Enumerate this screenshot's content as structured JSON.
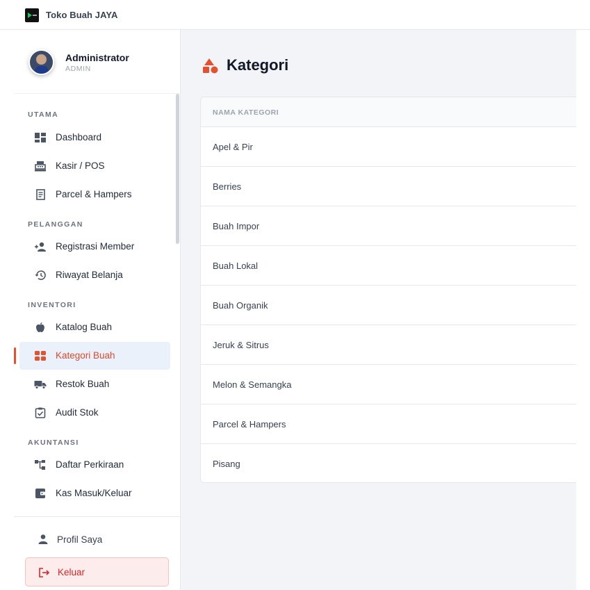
{
  "app": {
    "title": "Toko Buah JAYA"
  },
  "user": {
    "name": "Administrator",
    "role": "ADMIN"
  },
  "menu": {
    "sections": [
      {
        "title": "UTAMA",
        "items": [
          {
            "label": "Dashboard",
            "icon": "dashboard-icon"
          },
          {
            "label": "Kasir / POS",
            "icon": "cash-register-icon"
          },
          {
            "label": "Parcel & Hampers",
            "icon": "receipt-icon"
          }
        ]
      },
      {
        "title": "PELANGGAN",
        "items": [
          {
            "label": "Registrasi Member",
            "icon": "user-plus-icon"
          },
          {
            "label": "Riwayat Belanja",
            "icon": "history-icon"
          }
        ]
      },
      {
        "title": "INVENTORI",
        "items": [
          {
            "label": "Katalog Buah",
            "icon": "apple-icon"
          },
          {
            "label": "Kategori Buah",
            "icon": "grid-icon",
            "active": true
          },
          {
            "label": "Restok Buah",
            "icon": "truck-icon"
          },
          {
            "label": "Audit Stok",
            "icon": "clipboard-check-icon"
          }
        ]
      },
      {
        "title": "AKUNTANSI",
        "items": [
          {
            "label": "Daftar Perkiraan",
            "icon": "tree-icon"
          },
          {
            "label": "Kas Masuk/Keluar",
            "icon": "wallet-icon"
          }
        ]
      }
    ]
  },
  "footer": {
    "profile_label": "Profil Saya",
    "logout_label": "Keluar"
  },
  "page": {
    "title": "Kategori",
    "table": {
      "header": "NAMA KATEGORI",
      "rows": [
        "Apel & Pir",
        "Berries",
        "Buah Impor",
        "Buah Lokal",
        "Buah Organik",
        "Jeruk & Sitrus",
        "Melon & Semangka",
        "Parcel & Hampers",
        "Pisang"
      ]
    }
  },
  "colors": {
    "accent": "#e4512e",
    "active_bg": "#eaf1fb",
    "logout_text": "#dc2626",
    "main_bg": "#f3f4f8"
  }
}
